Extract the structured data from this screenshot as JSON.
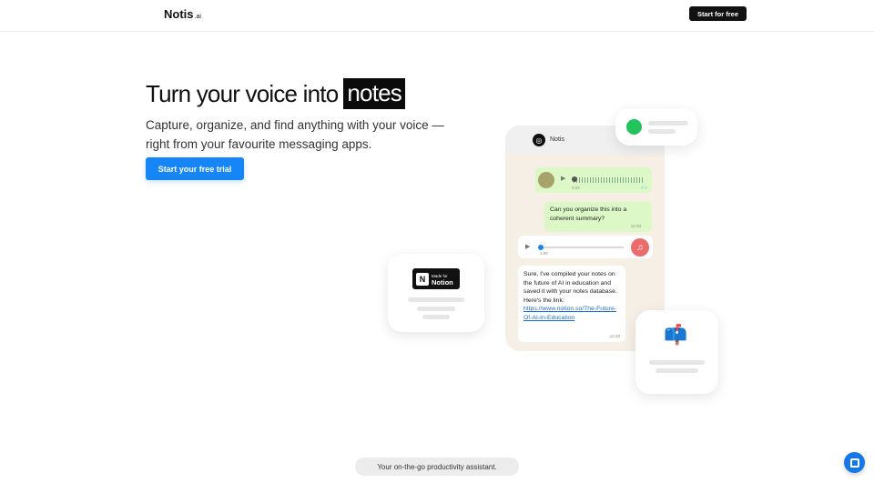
{
  "header": {
    "logo_text": "Notis",
    "logo_suffix": ".ai",
    "cta_label": "Start for free"
  },
  "hero": {
    "title_prefix": "Turn your voice into",
    "title_highlight": "notes",
    "subtitle": "Capture, organize, and find anything with your voice —right from your favourite messaging apps.",
    "cta_label": "Start your free trial"
  },
  "phone": {
    "chat_name": "Notis",
    "voice_message": {
      "duration": "0:22"
    },
    "outgoing_message": {
      "text": "Can you organize this into a coherent summary?",
      "time": "12:33"
    },
    "audio_message": {
      "duration": "1:00"
    },
    "incoming_message": {
      "text": "Sure, I've compiled your notes on the future of AI in education and saved it with your notes database. Here's the link:",
      "link": "https://www.notion.so/The-Future-Of-AI-In-Education",
      "time": "12:33"
    }
  },
  "cards": {
    "notion_badge": {
      "small": "Made for",
      "big": "Notion",
      "icon": "N"
    },
    "mailbox_icon": "📫"
  },
  "footer": {
    "tagline": "Your on-the-go productivity assistant."
  },
  "icons": {
    "play": "▶",
    "music": "♫",
    "tick": "✓✓"
  },
  "colors": {
    "primary": "#1685f5",
    "dark": "#111111",
    "bubble_out": "#dcf8c6",
    "status_green": "#23c45d",
    "music_red": "#ec6b6b"
  }
}
